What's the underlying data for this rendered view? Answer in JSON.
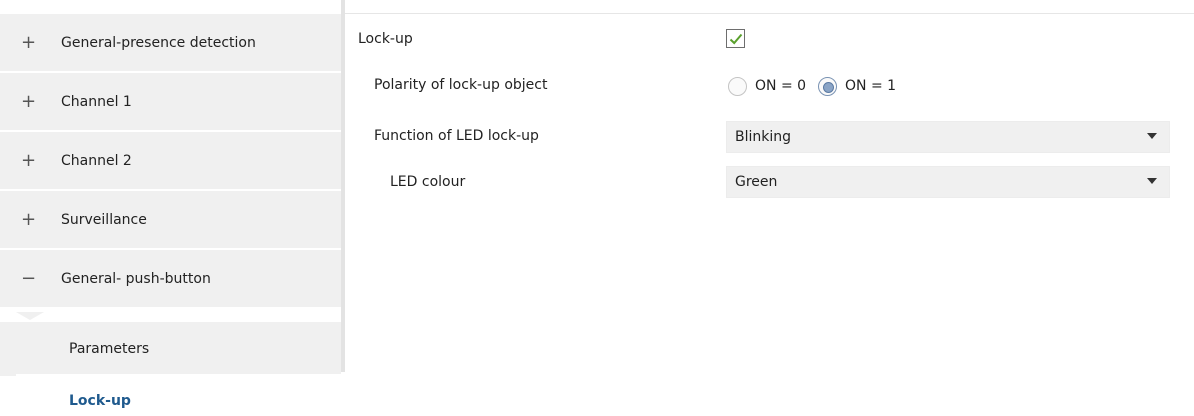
{
  "sidebar": {
    "items": [
      {
        "sign": "+",
        "label": "General-presence detection"
      },
      {
        "sign": "+",
        "label": "Channel 1"
      },
      {
        "sign": "+",
        "label": "Channel 2"
      },
      {
        "sign": "+",
        "label": "Surveillance"
      },
      {
        "sign": "−",
        "label": "General- push-button"
      }
    ],
    "sub_items": [
      {
        "label": "Parameters"
      },
      {
        "label": "Lock-up"
      }
    ]
  },
  "main": {
    "lockup": {
      "label": "Lock-up",
      "checked": true
    },
    "polarity": {
      "label": "Polarity of lock-up object",
      "options": [
        "ON = 0",
        "ON = 1"
      ],
      "selected": "ON = 1"
    },
    "led_function": {
      "label": "Function of LED lock-up",
      "value": "Blinking"
    },
    "led_colour": {
      "label": "LED colour",
      "value": "Green"
    }
  },
  "colors": {
    "check_mark": "#5aa02c",
    "active_sub_item": "#1f5a8e",
    "sidebar_bg": "#f0f0f0"
  }
}
